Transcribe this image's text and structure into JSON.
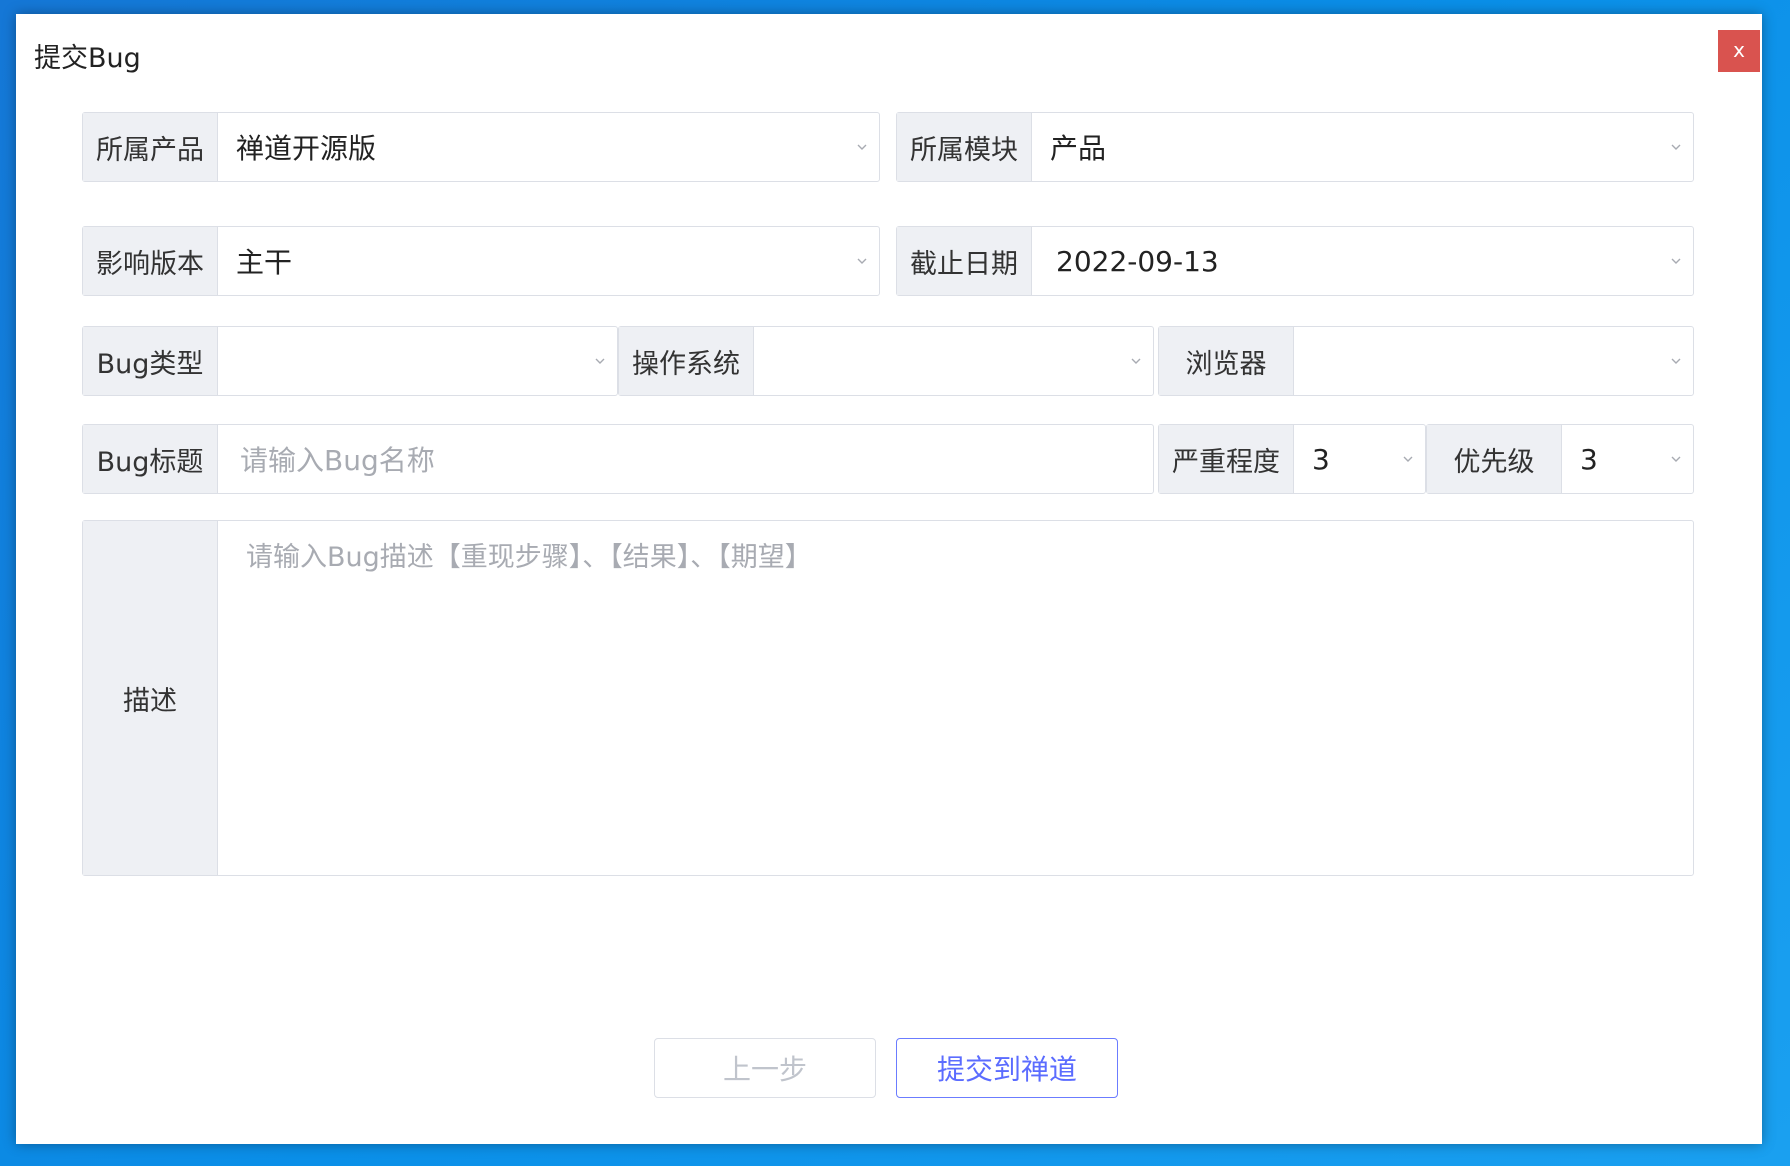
{
  "window": {
    "title": "提交Bug",
    "close_label": "x"
  },
  "form": {
    "product": {
      "label": "所属产品",
      "value": "禅道开源版"
    },
    "module": {
      "label": "所属模块",
      "value": "产品"
    },
    "version": {
      "label": "影响版本",
      "value": "主干"
    },
    "deadline": {
      "label": "截止日期",
      "value": "2022-09-13"
    },
    "bug_type": {
      "label": "Bug类型",
      "value": ""
    },
    "os": {
      "label": "操作系统",
      "value": ""
    },
    "browser": {
      "label": "浏览器",
      "value": ""
    },
    "bug_title": {
      "label": "Bug标题",
      "placeholder": "请输入Bug名称"
    },
    "severity": {
      "label": "严重程度",
      "value": "3"
    },
    "priority": {
      "label": "优先级",
      "value": "3"
    },
    "description": {
      "label": "描述",
      "placeholder": "请输入Bug描述【重现步骤】、【结果】、【期望】"
    }
  },
  "buttons": {
    "prev": "上一步",
    "submit": "提交到禅道"
  },
  "colors": {
    "accent": "#5b6cff",
    "close": "#d9534f",
    "label_bg": "#eef0f4"
  }
}
